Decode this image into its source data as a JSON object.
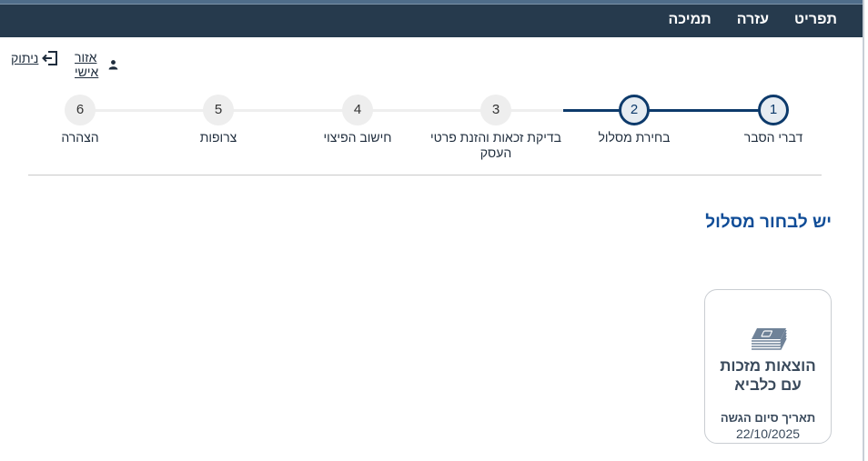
{
  "menu": {
    "items": [
      "תפריט",
      "עזרה",
      "תמיכה"
    ]
  },
  "account": {
    "personal_area": "אזור אישי",
    "logout": "ניתוק"
  },
  "steps": [
    {
      "num": "1",
      "label": "דברי הסבר"
    },
    {
      "num": "2",
      "label": "בחירת מסלול"
    },
    {
      "num": "3",
      "label": "בדיקת זכאות והזנת פרטי העסק"
    },
    {
      "num": "4",
      "label": "חישוב הפיצוי"
    },
    {
      "num": "5",
      "label": "צרופות"
    },
    {
      "num": "6",
      "label": "הצהרה"
    }
  ],
  "current_step": 2,
  "section": {
    "title": "יש לבחור מסלול"
  },
  "card": {
    "title": "הוצאות מזכות עם כלביא",
    "date_label": "תאריך סיום הגשה",
    "date": "22/10/2025"
  },
  "colors": {
    "topbar": "#263a4d",
    "accent": "#0d3a6b",
    "title": "#0f4c97"
  }
}
